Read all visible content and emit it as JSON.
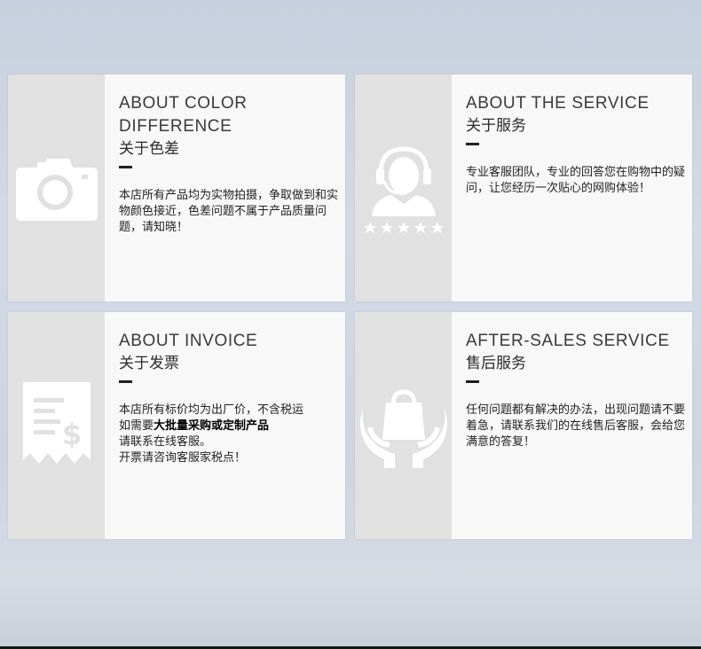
{
  "cards": [
    {
      "title": "ABOUT COLOR DIFFERENCE",
      "subtitle": "关于色差",
      "icon": "camera-icon",
      "body": "本店所有产品均为实物拍摄，争取做到和实物颜色接近，色差问题不属于产品质量问题，请知晓！"
    },
    {
      "title": "ABOUT THE SERVICE",
      "subtitle": "关于服务",
      "icon": "customer-service-icon",
      "body": "专业客服团队，专业的回答您在购物中的疑问，让您经历一次贴心的网购体验！"
    },
    {
      "title": "ABOUT INVOICE",
      "subtitle": "关于发票",
      "icon": "receipt-icon",
      "body_line1": "本店所有标价均为出厂价，不含税运",
      "body_line2_pre": "如需要",
      "body_line2_bold": "大批量采购或定制产品",
      "body_line3": "请联系在线客服。",
      "body_line4": "开票请咨询客服家税点！"
    },
    {
      "title": "AFTER-SALES SERVICE",
      "subtitle": "售后服务",
      "icon": "hands-bag-icon",
      "body": "任何问题都有解决的办法，出现问题请不要着急，请联系我们的在线售后客服，会给您满意的答复！"
    }
  ]
}
